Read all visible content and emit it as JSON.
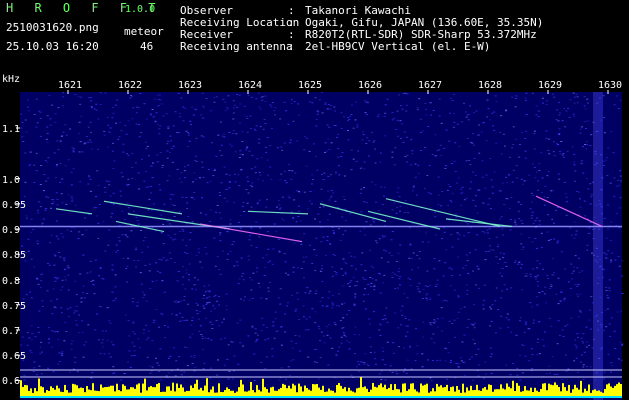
{
  "header": {
    "app_title": "H R O F F T",
    "app_version": "1.0.0",
    "filename": "2510031620.png",
    "timestamp": "25.10.03 16:20",
    "meteor_label": "meteor",
    "meteor_count": "46"
  },
  "info": [
    {
      "key": "Observer",
      "sep": ":",
      "value": "Takanori Kawachi"
    },
    {
      "key": "Receiving Location",
      "sep": ":",
      "value": "Ogaki, Gifu, JAPAN (136.60E, 35.35N)"
    },
    {
      "key": "Receiver",
      "sep": ":",
      "value": "R820T2(RTL-SDR) SDR-Sharp 53.372MHz"
    },
    {
      "key": "Receiving antenna",
      "sep": ":",
      "value": "2el-HB9CV Vertical (el. E-W)"
    }
  ],
  "chart_data": {
    "type": "heatmap",
    "ylabel": "kHz",
    "x_ticks": [
      "1621",
      "1622",
      "1623",
      "1624",
      "1625",
      "1626",
      "1627",
      "1628",
      "1629",
      "1630"
    ],
    "y_ticks": [
      "1.1",
      "1.0",
      "0.95",
      "0.9",
      "0.85",
      "0.8",
      "0.75",
      "0.7",
      "0.65",
      "0.6"
    ],
    "xlim": [
      1620.6,
      1630.2
    ],
    "ylim": [
      0.6,
      1.15
    ],
    "carrier_khz": 0.905,
    "meteor_count": 46,
    "colors": {
      "background": "#000064",
      "noise": "#3a3aff",
      "echo": "#7fffd0",
      "strong": "#ff70ff",
      "activity_bar": "#ffff00",
      "baseline": "#00e0ff"
    }
  }
}
